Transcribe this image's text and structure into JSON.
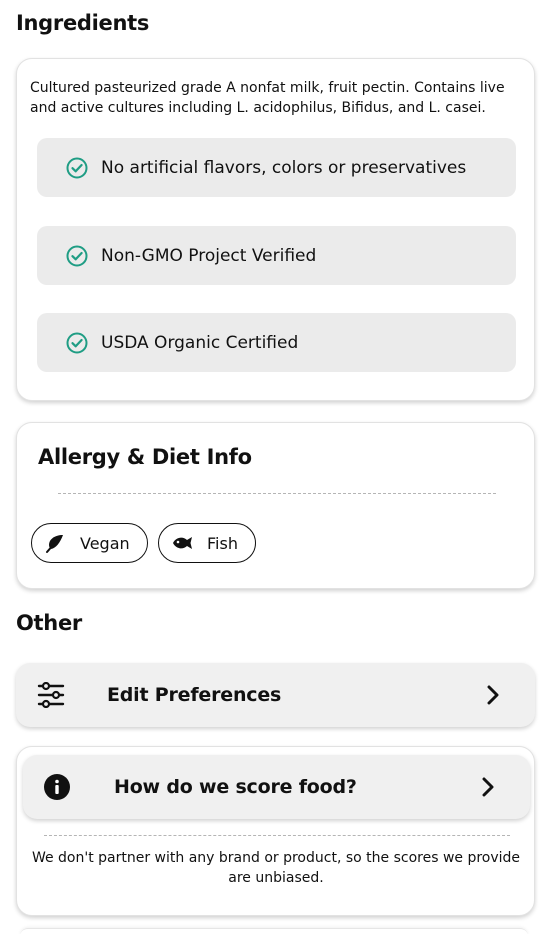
{
  "ingredients": {
    "title": "Ingredients",
    "description": "Cultured pasteurized grade A nonfat milk, fruit pectin. Contains live and active cultures including L. acidophilus, Bifidus, and L. casei.",
    "badges": [
      {
        "label": "No artificial flavors, colors or preservatives",
        "icon": "check-circle-icon"
      },
      {
        "label": "Non-GMO Project Verified",
        "icon": "check-circle-icon"
      },
      {
        "label": "USDA Organic Certified",
        "icon": "check-circle-icon"
      }
    ]
  },
  "allergy": {
    "title": "Allergy & Diet Info",
    "tags": [
      {
        "label": "Vegan",
        "icon": "leaf-icon"
      },
      {
        "label": "Fish",
        "icon": "fish-icon"
      }
    ]
  },
  "other": {
    "title": "Other",
    "edit_preferences": {
      "label": "Edit Preferences",
      "icon": "sliders-icon"
    },
    "score_info": {
      "label": "How do we score food?",
      "icon": "info-icon"
    },
    "note": "We don't partner with any brand or product, so the scores we provide are unbiased."
  },
  "colors": {
    "accent_green": "#1f9d84",
    "badge_bg": "#ebebeb",
    "row_bg": "#f0f0f0"
  }
}
